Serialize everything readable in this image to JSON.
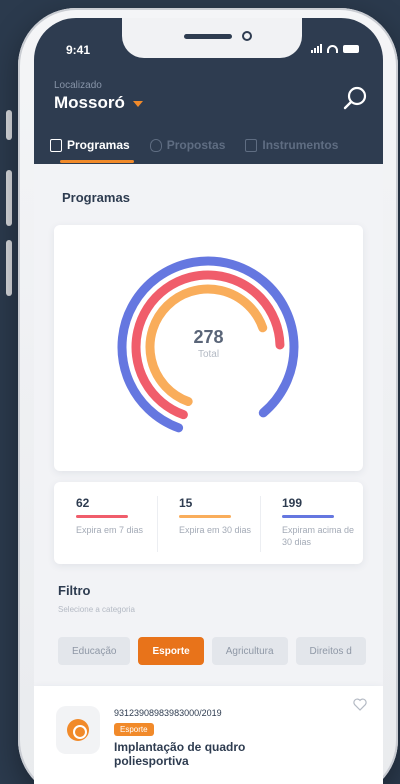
{
  "status_bar": {
    "time": "9:41"
  },
  "header": {
    "location_label": "Localizado",
    "city": "Mossoró",
    "tabs": [
      {
        "label": "Programas",
        "icon": "document-icon",
        "active": true
      },
      {
        "label": "Propostas",
        "icon": "lightbulb-icon",
        "active": false
      },
      {
        "label": "Instrumentos",
        "icon": "building-icon",
        "active": false
      }
    ]
  },
  "main": {
    "section_title": "Programas",
    "chart": {
      "total_value": "278",
      "total_label": "Total"
    },
    "stats": [
      {
        "value": "62",
        "description": "Expira em 7 dias",
        "color": "#f05d6b"
      },
      {
        "value": "15",
        "description": "Expira em 30 dias",
        "color": "#f9ad5b"
      },
      {
        "value": "199",
        "description": "Expiram acima de 30 dias",
        "color": "#6577e0"
      }
    ],
    "filter": {
      "title": "Filtro",
      "subtitle": "Selecione a categoria",
      "chips": [
        {
          "label": "Educação",
          "active": false
        },
        {
          "label": "Esporte",
          "active": true
        },
        {
          "label": "Agricultura",
          "active": false
        },
        {
          "label": "Direitos d",
          "active": false
        }
      ]
    },
    "program": {
      "code": "93123908983983000/2019",
      "badge": "Esporte",
      "title": "Implantação de quadro poliesportiva"
    }
  },
  "chart_data": {
    "type": "donut",
    "title": "",
    "total": 278,
    "series": [
      {
        "name": "Expiram acima de 30 dias",
        "value": 199,
        "color": "#6577e0"
      },
      {
        "name": "Expira em 7 dias",
        "value": 62,
        "color": "#f05d6b"
      },
      {
        "name": "Expira em 30 dias",
        "value": 15,
        "color": "#f9ad5b"
      }
    ]
  },
  "colors": {
    "header_bg": "#2e3c50",
    "accent": "#f18a2a"
  }
}
